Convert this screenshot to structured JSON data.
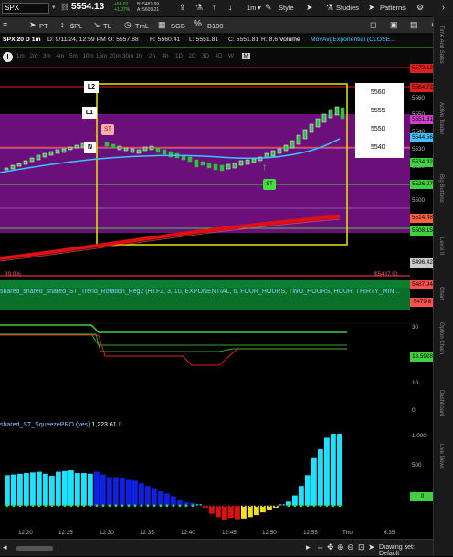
{
  "toolbar": {
    "symbol": "SPX",
    "price": "5554.13",
    "change": "+58.61",
    "change_pct": "+1.07%",
    "bid": "B: 5481.99",
    "ask": "A: 5609.21",
    "icons": [
      "share-icon",
      "flask-icon",
      "up-arrow-icon",
      "down-arrow-icon"
    ]
  },
  "tools": {
    "pt": "PT",
    "pl": "$PL",
    "tl": "TL",
    "tml": "TmL",
    "sgb": "SGB",
    "b180": "B180",
    "interval": "1m",
    "style": "Style",
    "studies": "Studies",
    "patterns": "Patterns"
  },
  "info": {
    "title": "SPX 20 D 1m",
    "date": "D: 9/11/24, 12:59 PM",
    "open": "O: 5557.88",
    "high": "H: 5560.41",
    "low": "L: 5551.81",
    "close": "C: 5551.81",
    "range": "R: 8.6",
    "volume": "Volume",
    "study": "MovAvgExponential (CLOSE..."
  },
  "timeframes": [
    "1m",
    "2m",
    "3m",
    "4m",
    "5m",
    "10m",
    "15m",
    "20m",
    "30m",
    "1h",
    "2h",
    "4h",
    "1D",
    "2D",
    "3D",
    "4D",
    "W",
    "M"
  ],
  "timeframe_selected": "M",
  "main_yaxis": {
    "ticks": [
      "5560",
      "5550",
      "5540",
      "5530",
      "5520",
      "5510",
      "5500",
      "5490"
    ],
    "badges": [
      {
        "label": "5572.12",
        "color": "#e02020"
      },
      {
        "label": "5564.72",
        "color": "#e02020"
      },
      {
        "label": "5551.81",
        "color": "#d040d0"
      },
      {
        "label": "5544.56",
        "color": "#40c0ff"
      },
      {
        "label": "5534.92",
        "color": "#40d040"
      },
      {
        "label": "5526.27",
        "color": "#40d040"
      },
      {
        "label": "5514.48",
        "color": "#ff6040"
      },
      {
        "label": "5508.15",
        "color": "#40d040"
      },
      {
        "label": "5496.42",
        "color": "#cccccc"
      },
      {
        "label": "5487.94",
        "color": "#ff5050"
      },
      {
        "label": "5479.8",
        "color": "#ff5050"
      }
    ]
  },
  "main_labels": {
    "l2": "L2",
    "l1": "L1",
    "n": "N",
    "st_top": "ST",
    "st_bottom": "ST",
    "pct": "89.0%",
    "price_right": "$5487.91"
  },
  "levels_box": [
    "5560",
    "5555",
    "5550",
    "5540"
  ],
  "st_study": {
    "title": "shared_shared_shared_ST_Trend_Rotation_Reg2 (HTF2, 3, 10, EXPONENTIAL, 6, FOUR_HOURS, TWO_HOURS, HOUR, THIRTY_MIN...",
    "ticks": [
      "30",
      "20",
      "10",
      "0"
    ],
    "badge": "18.5928"
  },
  "squeeze": {
    "title": "shared_ST_SqueezePRO (yes)",
    "value": "1,223.61",
    "zero": "0",
    "ticks": [
      "1,000",
      "500",
      "0"
    ]
  },
  "chart_data": {
    "type": "bar",
    "title": "shared_ST_SqueezePRO (yes)",
    "values": [
      450,
      460,
      470,
      480,
      490,
      500,
      470,
      440,
      500,
      510,
      520,
      480,
      480,
      470,
      500,
      460,
      420,
      420,
      400,
      380,
      370,
      330,
      290,
      260,
      210,
      180,
      140,
      80,
      50,
      40,
      20,
      -30,
      -120,
      -170,
      -210,
      -180,
      -200,
      -190,
      -170,
      -140,
      -100,
      -60,
      -30,
      20,
      60,
      150,
      290,
      450,
      700,
      830,
      1000,
      1060,
      1060
    ],
    "ylim": [
      -300,
      1100
    ]
  },
  "xaxis": [
    "12:20",
    "12:25",
    "12:30",
    "12:35",
    "12:40",
    "12:45",
    "12:50",
    "12:55",
    "Thu",
    "6:35"
  ],
  "status": {
    "drawing_set": "Drawing set: Default"
  },
  "right_tabs": [
    "Time And Sales",
    "Active Trader",
    "Big Buttons",
    "Level II",
    "Chart",
    "Option Chain",
    "Dashboard",
    "Live News"
  ]
}
